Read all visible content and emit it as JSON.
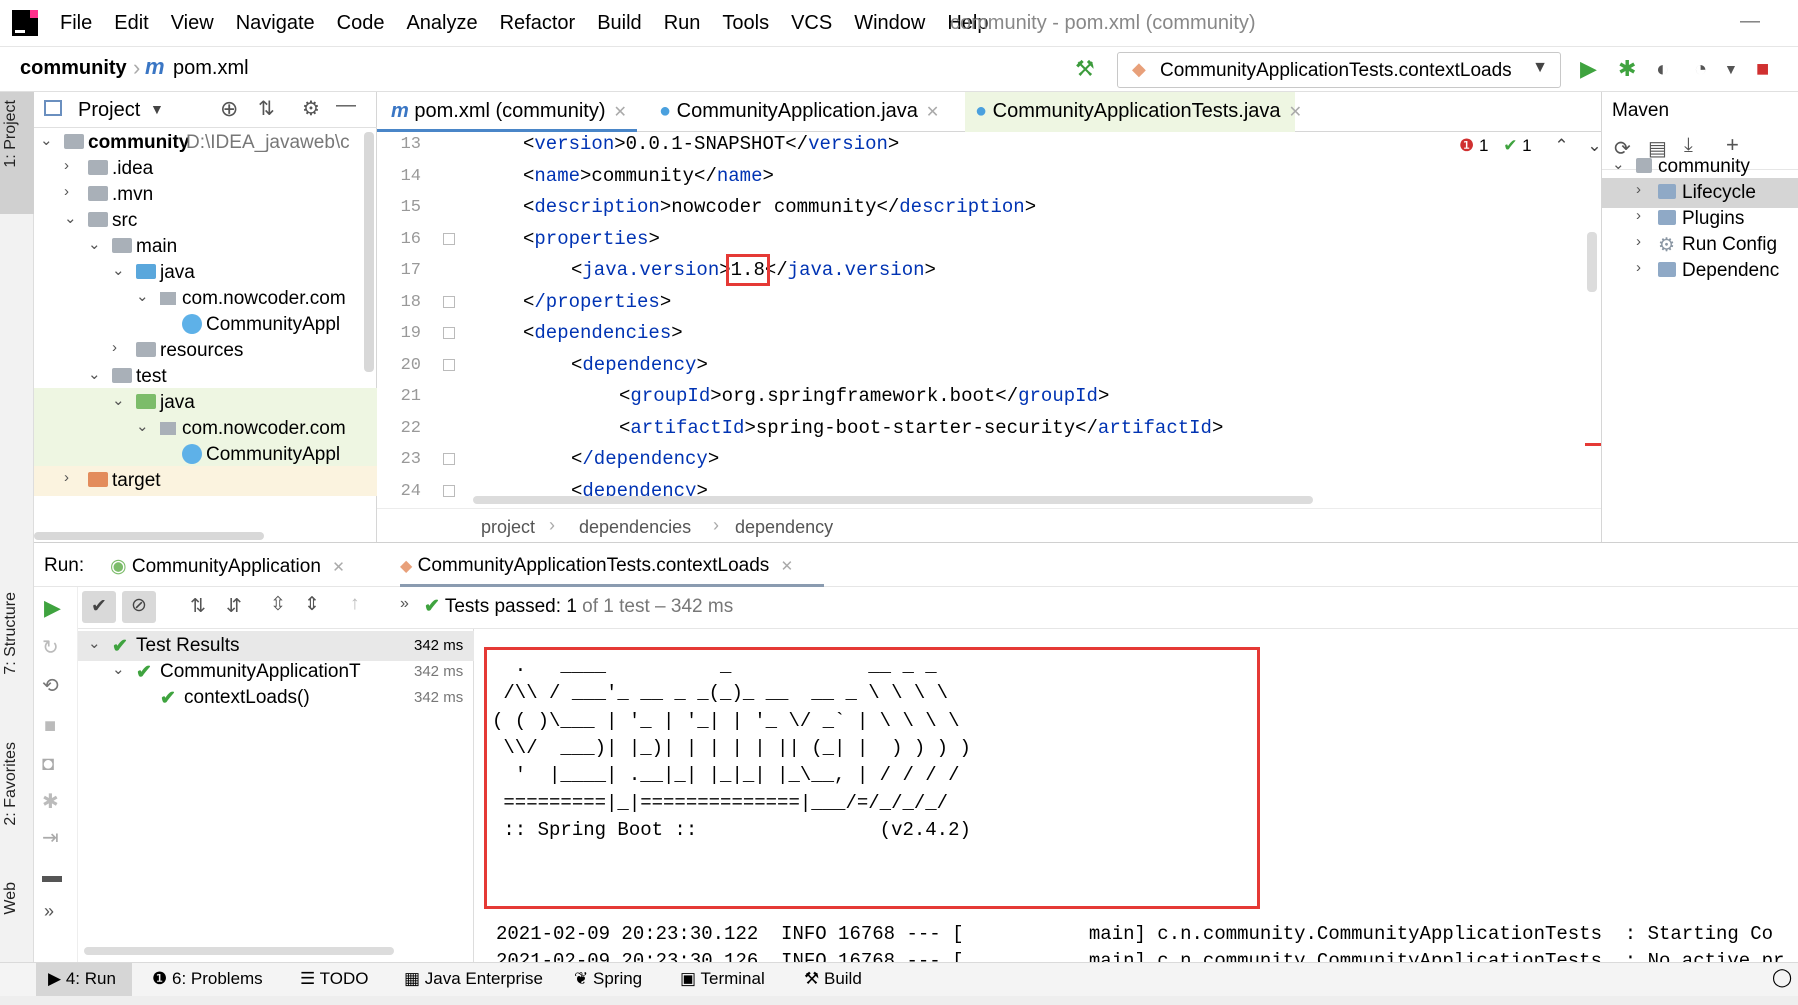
{
  "menubar": {
    "items": [
      "File",
      "Edit",
      "View",
      "Navigate",
      "Code",
      "Analyze",
      "Refactor",
      "Build",
      "Run",
      "Tools",
      "VCS",
      "Window",
      "Help"
    ],
    "window_title": "community - pom.xml (community)"
  },
  "navbar": {
    "project": "community",
    "file": "pom.xml",
    "run_config": "CommunityApplicationTests.contextLoads"
  },
  "left_tool_tabs": [
    "1: Project",
    "7: Structure",
    "2: Favorites",
    "Web"
  ],
  "project_panel": {
    "title": "Project",
    "tree": [
      {
        "label": "community",
        "path": "D:\\IDEA_javaweb\\c",
        "bold": true
      },
      {
        "label": ".idea"
      },
      {
        "label": ".mvn"
      },
      {
        "label": "src"
      },
      {
        "label": "main"
      },
      {
        "label": "java"
      },
      {
        "label": "com.nowcoder.com"
      },
      {
        "label": "CommunityAppl"
      },
      {
        "label": "resources"
      },
      {
        "label": "test"
      },
      {
        "label": "java"
      },
      {
        "label": "com.nowcoder.com"
      },
      {
        "label": "CommunityAppl"
      },
      {
        "label": "target"
      }
    ]
  },
  "editor_tabs": [
    {
      "label": "pom.xml (community)",
      "icon": "m"
    },
    {
      "label": "CommunityApplication.java",
      "icon": "c"
    },
    {
      "label": "CommunityApplicationTests.java",
      "icon": "c"
    }
  ],
  "editor": {
    "problems": {
      "errors": "1",
      "warnings": "1"
    },
    "lines": [
      {
        "n": "13",
        "indent": "",
        "open": "version",
        "text": "0.0.1-SNAPSHOT",
        "close": "version"
      },
      {
        "n": "14",
        "indent": "",
        "open": "name",
        "text": "community",
        "close": "name"
      },
      {
        "n": "15",
        "indent": "",
        "open": "description",
        "text": "nowcoder community",
        "close": "description"
      },
      {
        "n": "16",
        "indent": "",
        "open": "properties",
        "text": "",
        "close": ""
      },
      {
        "n": "17",
        "indent": "    ",
        "open": "java.version",
        "text": "1.8",
        "close": "java.version"
      },
      {
        "n": "18",
        "indent": "",
        "open": "/properties",
        "text": "",
        "close": ""
      },
      {
        "n": "19",
        "indent": "",
        "open": "dependencies",
        "text": "",
        "close": ""
      },
      {
        "n": "20",
        "indent": "    ",
        "open": "dependency",
        "text": "",
        "close": ""
      },
      {
        "n": "21",
        "indent": "        ",
        "open": "groupId",
        "text": "org.springframework.boot",
        "close": "groupId"
      },
      {
        "n": "22",
        "indent": "        ",
        "open": "artifactId",
        "text": "spring-boot-starter-security",
        "close": "artifactId"
      },
      {
        "n": "23",
        "indent": "    ",
        "open": "/dependency",
        "text": "",
        "close": ""
      },
      {
        "n": "24",
        "indent": "    ",
        "open": "dependency",
        "text": "",
        "close": ""
      }
    ],
    "breadcrumbs": [
      "project",
      "dependencies",
      "dependency"
    ]
  },
  "maven": {
    "title": "Maven",
    "tree": [
      {
        "label": "community"
      },
      {
        "label": "Lifecycle"
      },
      {
        "label": "Plugins"
      },
      {
        "label": "Run Config"
      },
      {
        "label": "Dependenc"
      }
    ]
  },
  "run": {
    "label": "Run:",
    "tabs": [
      "CommunityApplication",
      "CommunityApplicationTests.contextLoads"
    ],
    "status_prefix": "Tests passed:",
    "status_count": "1",
    "status_rest": "of 1 test – 342 ms",
    "tests": [
      {
        "label": "Test Results",
        "time": "342 ms"
      },
      {
        "label": "CommunityApplicationT",
        "time": "342 ms"
      },
      {
        "label": "contextLoads()",
        "time": "342 ms"
      }
    ],
    "banner": [
      "  .   ____          _            __ _ _",
      " /\\\\ / ___'_ __ _ _(_)_ __  __ _ \\ \\ \\ \\",
      "( ( )\\___ | '_ | '_| | '_ \\/ _` | \\ \\ \\ \\",
      " \\\\/  ___)| |_)| | | | | || (_| |  ) ) ) )",
      "  '  |____| .__|_| |_|_| |_\\__, | / / / /",
      " =========|_|==============|___/=/_/_/_/",
      " :: Spring Boot ::                (v2.4.2)"
    ],
    "logs": [
      "2021-02-09 20:23:30.122  INFO 16768 --- [           main] c.n.community.CommunityApplicationTests  : Starting Co",
      "2021-02-09 20:23:30.126  INFO 16768 --- [           main] c.n.community.CommunityApplicationTests  : No active pr"
    ]
  },
  "bottom_bar": [
    "4: Run",
    "6: Problems",
    "TODO",
    "Java Enterprise",
    "Spring",
    "Terminal",
    "Build"
  ],
  "colors": {
    "accent": "#3fa33f",
    "highlight": "#e53935",
    "tag": "#0033b3"
  }
}
